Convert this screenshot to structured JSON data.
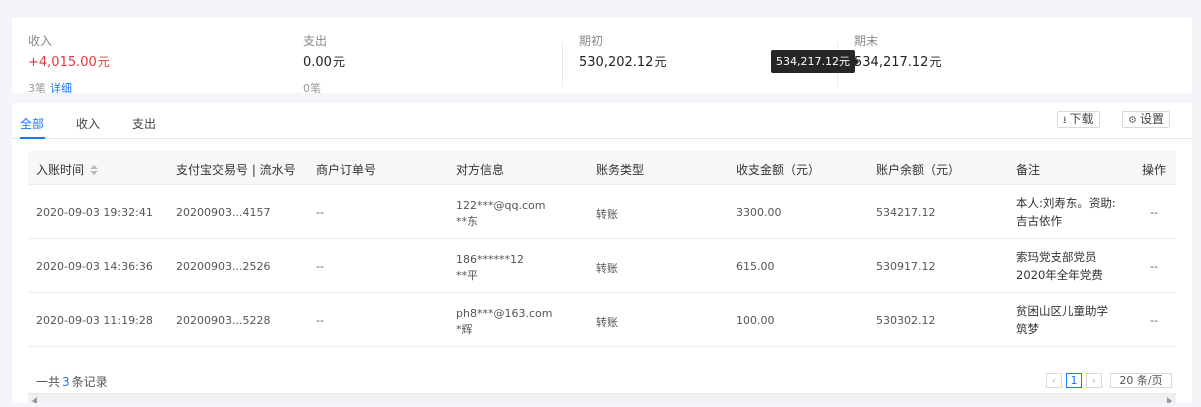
{
  "summary": {
    "income": {
      "label": "收入",
      "value": "+4,015.00",
      "unit": "元",
      "sub_count": "3笔",
      "sub_link": "详细"
    },
    "expense": {
      "label": "支出",
      "value": "0.00",
      "unit": "元",
      "sub_count": "0笔"
    },
    "opening": {
      "label": "期初",
      "value": "530,202.12",
      "unit": "元"
    },
    "closing": {
      "label": "期末",
      "value": "534,217.12",
      "unit": "元"
    },
    "tooltip": "534,217.12元"
  },
  "tabs": [
    {
      "label": "全部",
      "active": true
    },
    {
      "label": "收入",
      "active": false
    },
    {
      "label": "支出",
      "active": false
    }
  ],
  "toolbar": {
    "download_label": "下载",
    "settings_label": "设置"
  },
  "table": {
    "columns": [
      "入账时间",
      "支付宝交易号 | 流水号",
      "商户订单号",
      "对方信息",
      "账务类型",
      "收支金额（元）",
      "账户余额（元）",
      "备注",
      "操作"
    ],
    "rows": [
      {
        "time": "2020-09-03 19:32:41",
        "trade_no": "20200903...4157",
        "order_no": "--",
        "party_account": "122***@qq.com",
        "party_name": "**东",
        "type": "转账",
        "amount": "3300.00",
        "balance": "534217.12",
        "note": "本人:刘寿东。资助:吉古依作",
        "action": "--"
      },
      {
        "time": "2020-09-03 14:36:36",
        "trade_no": "20200903...2526",
        "order_no": "--",
        "party_account": "186******12",
        "party_name": "**平",
        "type": "转账",
        "amount": "615.00",
        "balance": "530917.12",
        "note": "索玛党支部党员2020年全年党费",
        "action": "--"
      },
      {
        "time": "2020-09-03 11:19:28",
        "trade_no": "20200903...5228",
        "order_no": "--",
        "party_account": "ph8***@163.com",
        "party_name": "*辉",
        "type": "转账",
        "amount": "100.00",
        "balance": "530302.12",
        "note": "贫困山区儿童助学筑梦",
        "action": "--"
      }
    ]
  },
  "footer": {
    "total_prefix": "一共",
    "total_count": "3",
    "total_suffix": "条记录",
    "current_page": "1",
    "page_size": "20 条/页"
  },
  "colors": {
    "accent": "#1677ff",
    "income": "#e4393c"
  },
  "icons": {
    "download": "download-icon",
    "settings": "gear-icon",
    "sort": "sort-icon"
  }
}
